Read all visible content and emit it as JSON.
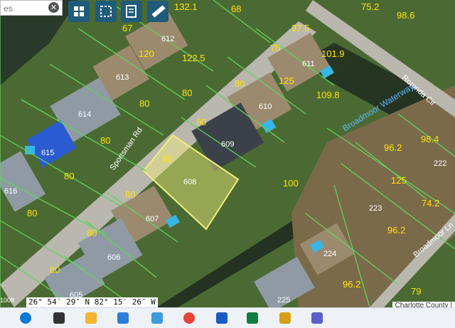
{
  "search": {
    "placeholder": "es"
  },
  "toolbar": {
    "tools": [
      {
        "icon": "grid-icon"
      },
      {
        "icon": "select-box-icon"
      },
      {
        "icon": "notes-edit-icon"
      },
      {
        "icon": "ruler-icon"
      }
    ]
  },
  "streets": {
    "sportsman": "Sportsman Rd",
    "rotonda": "Rotonda Cir",
    "broadmoor_lane": "Broadmoor Ln",
    "waterway": "Broadmoor Waterway"
  },
  "parcels": {
    "lots": [
      "612",
      "613",
      "614",
      "615",
      "616",
      "611",
      "610",
      "609",
      "608",
      "607",
      "606",
      "605",
      "222",
      "223",
      "224",
      "225"
    ],
    "dims": [
      "132.1",
      "68",
      "67",
      "120",
      "122.5",
      "80",
      "80",
      "80",
      "80",
      "37.5",
      "101.9",
      "75",
      "125",
      "109.8",
      "80",
      "80",
      "100",
      "96.2",
      "98.4",
      "125",
      "74.2",
      "96.2",
      "80",
      "80",
      "80",
      "80",
      "80",
      "75.2",
      "98.6",
      "96.2",
      "79"
    ]
  },
  "coordinates": "26° 54′ 29″ N 82° 15′ 26″ W",
  "scale_label": "100ft",
  "county_label": "Charlotte County |",
  "colors": {
    "parcel_line": "#5fd35a",
    "dimension_text": "#ffe400",
    "selected_fill": "#f2f07a",
    "toolbar_bg": "#1f5b7a"
  },
  "taskbar": {
    "apps": [
      "windows-icon",
      "search-icon",
      "task-view-icon",
      "file-explorer-icon",
      "edge-icon",
      "chrome-icon",
      "word-icon",
      "mail-icon",
      "excel-icon",
      "files-icon"
    ]
  }
}
